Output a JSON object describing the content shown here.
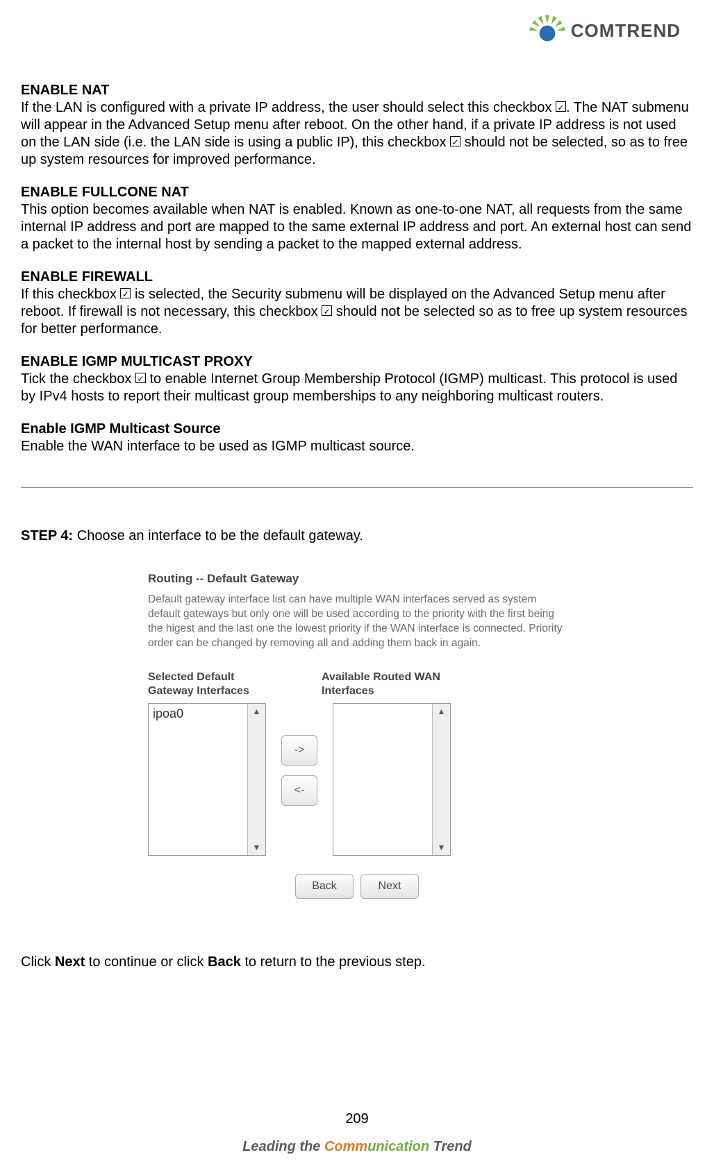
{
  "brand": {
    "name": "COMTREND"
  },
  "sections": [
    {
      "heading": "ENABLE NAT",
      "body_parts": [
        "If the LAN is configured with a private IP address, the user should select this checkbox ",
        ".   The NAT submenu will appear in the Advanced Setup menu after reboot. On the other hand, if a private IP address is not used on the LAN side (i.e. the LAN side is using a public IP), this checkbox ",
        " should not be selected, so as to free up system resources for improved performance."
      ],
      "chk_after": [
        0,
        1
      ]
    },
    {
      "heading": "ENABLE FULLCONE NAT",
      "body": "This option becomes available when NAT is enabled. Known as one-to-one NAT, all requests from the same internal IP address and port are mapped to the same external IP address and port. An external host can send a packet to the internal host by sending a packet to the mapped external address."
    },
    {
      "heading": "ENABLE FIREWALL",
      "body_parts": [
        "If this checkbox ",
        " is selected, the Security submenu will be displayed on the Advanced Setup menu after reboot.   If firewall is not necessary, this checkbox ",
        " should not be selected so as to free up system resources for better performance."
      ],
      "chk_after": [
        0,
        1
      ]
    },
    {
      "heading": "ENABLE IGMP MULTICAST PROXY",
      "body_parts": [
        "Tick the checkbox ",
        " to enable Internet Group Membership Protocol (IGMP) multicast. This protocol is used by IPv4 hosts to report their multicast group memberships to any neighboring multicast routers."
      ],
      "chk_after": [
        0
      ]
    },
    {
      "heading": "Enable IGMP Multicast Source",
      "body": "Enable the WAN interface to be used as IGMP multicast source."
    }
  ],
  "step": {
    "label": "STEP 4:",
    "text": "Choose an interface to be the default gateway."
  },
  "panel": {
    "title": "Routing -- Default Gateway",
    "desc": "Default gateway interface list can have multiple WAN interfaces served as system default gateways but only one will be used according to the priority with the first being the higest and the last one the lowest priority if the WAN interface is connected. Priority order can be changed by removing all and adding them back in again.",
    "left_label_l1": "Selected Default",
    "left_label_l2": "Gateway Interfaces",
    "right_label_l1": "Available Routed WAN",
    "right_label_l2": "Interfaces",
    "selected_items": [
      "ipoa0"
    ],
    "available_items": [],
    "move_right": "->",
    "move_left": "<-",
    "back": "Back",
    "next": "Next"
  },
  "after_shot_parts": {
    "p0": "Click ",
    "b1": "Next",
    "p1": " to continue or click ",
    "b2": "Back",
    "p2": " to return to the previous step."
  },
  "page_number": "209",
  "footer": {
    "p0": "Leading the ",
    "p1": "Comm",
    "p2": "unication",
    "p3": " Trend"
  }
}
